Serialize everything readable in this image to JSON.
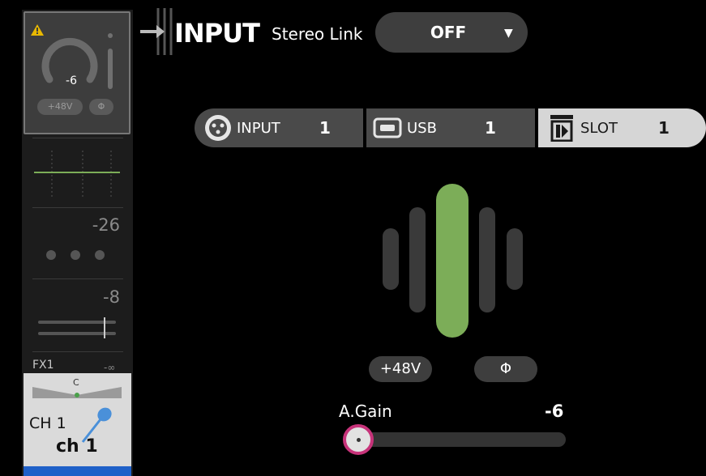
{
  "header": {
    "title": "INPUT",
    "stereo_link_label": "Stereo Link",
    "stereo_link_value": "OFF"
  },
  "channel_strip": {
    "gain_value": "-6",
    "phantom_label": "+48V",
    "phase_label": "Φ",
    "value_1": "-26",
    "value_2": "-8",
    "fx_label": "FX1",
    "fx_value": "-∞",
    "pan_label": "C",
    "channel_label": "CH 1",
    "channel_name": "ch 1"
  },
  "sources": [
    {
      "label": "INPUT",
      "number": "1",
      "icon": "xlr-jack-icon",
      "selected": false
    },
    {
      "label": "USB",
      "number": "1",
      "icon": "usb-icon",
      "selected": false
    },
    {
      "label": "SLOT",
      "number": "1",
      "icon": "slot-icon",
      "selected": true
    }
  ],
  "gain": {
    "phantom_label": "+48V",
    "phase_label": "Φ",
    "label": "A.Gain",
    "value": "-6",
    "slider_position": 0
  },
  "colors": {
    "accent_green": "#7cad58",
    "knob_ring": "#c7337a",
    "warning": "#e8b800",
    "bottom_bar": "#1f60c8",
    "selected_source_bg": "#d6d6d6"
  }
}
